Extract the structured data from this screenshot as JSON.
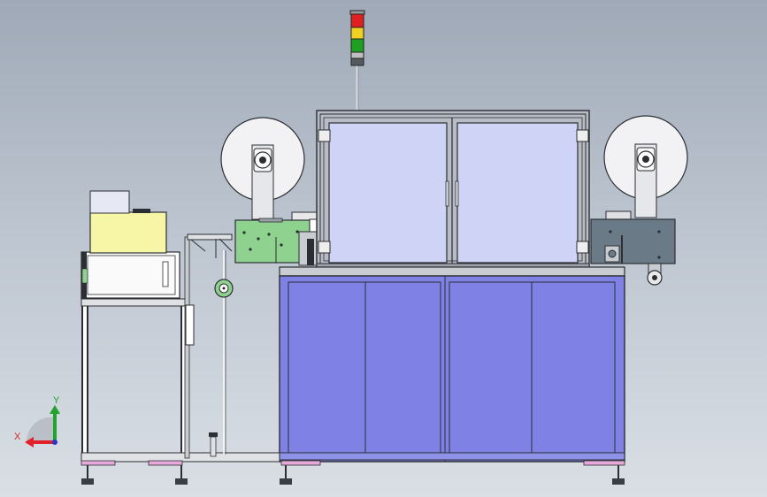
{
  "axis_triad": {
    "x_label": "X",
    "y_label": "Y"
  },
  "colors": {
    "frame_dark": "#2b2e33",
    "frame_light": "#b8bcc4",
    "cabinet_blue": "#7f82e4",
    "window_pane": "#cfd3f6",
    "reel_disk": "#f2f2f4",
    "left_plate_green": "#8fd18f",
    "right_housing_gray": "#6a7a86",
    "yellow_box": "#f7f6a6",
    "foot_pink": "#e7a9d9",
    "tower_red": "#e02020",
    "tower_yellow": "#f0d020",
    "tower_green": "#20a020"
  }
}
